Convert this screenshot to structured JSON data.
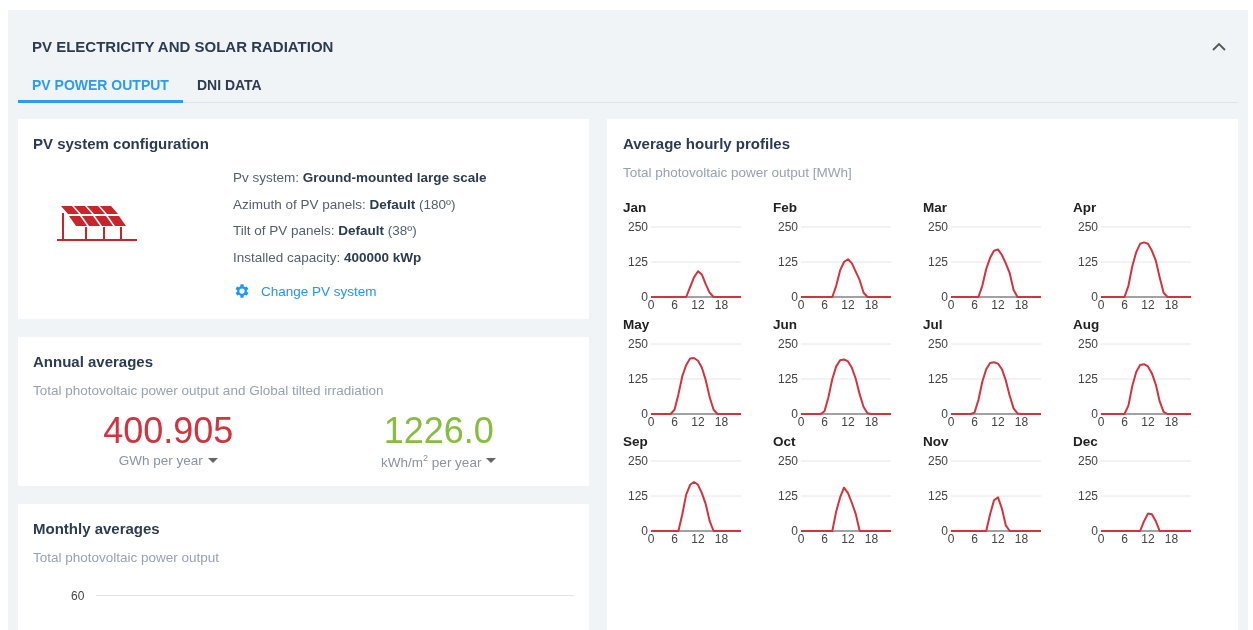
{
  "section": {
    "title": "PV ELECTRICITY AND SOLAR RADIATION",
    "expanded": true
  },
  "tabs": [
    {
      "label": "PV POWER OUTPUT",
      "selected": true
    },
    {
      "label": "DNI DATA",
      "selected": false
    }
  ],
  "config": {
    "title": "PV system configuration",
    "lines": [
      "Pv system: **Ground-mounted large scale**",
      "Azimuth of PV panels: **Default** (180º)",
      "Tilt of PV panels: **Default** (38º)",
      "Installed capacity: **400000 kWp**"
    ],
    "link": "Change PV system"
  },
  "annual": {
    "title": "Annual averages",
    "subtitle": "Total photovoltaic power output and Global tilted irradiation",
    "values": [
      {
        "value": "400.905",
        "unit": "GWh per year",
        "color": "#d0343f"
      },
      {
        "value": "1226.0",
        "unit": "kWh/m$^{2}$ per year",
        "color": "#86bd3f"
      }
    ]
  },
  "monthly": {
    "title": "Monthly averages",
    "subtitle": "Total photovoltaic power output",
    "y_tick_label": "60"
  },
  "hourly": {
    "title": "Average hourly profiles",
    "subtitle": "Total photovoltaic power output [MWh]",
    "charts": [
      {
        "chart_data": {
          "type": "line",
          "title": "Jan",
          "x": [
            0,
            1,
            2,
            3,
            4,
            5,
            6,
            7,
            8,
            9,
            10,
            11,
            12,
            13,
            14,
            15,
            16,
            17,
            18,
            19,
            20,
            21,
            22,
            23
          ],
          "series": [
            {
              "color": "#d0343f",
              "values": [
                0,
                0,
                0,
                0,
                0,
                0,
                0,
                0,
                0,
                0,
                35,
                70,
                92,
                80,
                45,
                15,
                0,
                0,
                0,
                0,
                0,
                0,
                0,
                0
              ]
            }
          ],
          "xlim": [
            0,
            23
          ],
          "ylim": [
            0,
            250
          ],
          "xticks": [
            0,
            6,
            12,
            18
          ],
          "yticks": [
            0,
            125,
            250
          ]
        }
      },
      {
        "chart_data": {
          "type": "line",
          "title": "Feb",
          "x": [
            0,
            1,
            2,
            3,
            4,
            5,
            6,
            7,
            8,
            9,
            10,
            11,
            12,
            13,
            14,
            15,
            16,
            17,
            18,
            19,
            20,
            21,
            22,
            23
          ],
          "series": [
            {
              "color": "#d0343f",
              "values": [
                0,
                0,
                0,
                0,
                0,
                0,
                0,
                0,
                0,
                40,
                95,
                125,
                135,
                120,
                90,
                60,
                15,
                0,
                0,
                0,
                0,
                0,
                0,
                0
              ]
            }
          ],
          "xlim": [
            0,
            23
          ],
          "ylim": [
            0,
            250
          ],
          "xticks": [
            0,
            6,
            12,
            18
          ],
          "yticks": [
            0,
            125,
            250
          ]
        }
      },
      {
        "chart_data": {
          "type": "line",
          "title": "Mar",
          "x": [
            0,
            1,
            2,
            3,
            4,
            5,
            6,
            7,
            8,
            9,
            10,
            11,
            12,
            13,
            14,
            15,
            16,
            17,
            18,
            19,
            20,
            21,
            22,
            23
          ],
          "series": [
            {
              "color": "#d0343f",
              "values": [
                0,
                0,
                0,
                0,
                0,
                0,
                0,
                0,
                40,
                100,
                140,
                165,
                170,
                150,
                120,
                85,
                25,
                0,
                0,
                0,
                0,
                0,
                0,
                0
              ]
            }
          ],
          "xlim": [
            0,
            23
          ],
          "ylim": [
            0,
            250
          ],
          "xticks": [
            0,
            6,
            12,
            18
          ],
          "yticks": [
            0,
            125,
            250
          ]
        }
      },
      {
        "chart_data": {
          "type": "line",
          "title": "Apr",
          "x": [
            0,
            1,
            2,
            3,
            4,
            5,
            6,
            7,
            8,
            9,
            10,
            11,
            12,
            13,
            14,
            15,
            16,
            17,
            18,
            19,
            20,
            21,
            22,
            23
          ],
          "series": [
            {
              "color": "#d0343f",
              "values": [
                0,
                0,
                0,
                0,
                0,
                0,
                0,
                40,
                110,
                160,
                190,
                195,
                190,
                165,
                130,
                70,
                15,
                0,
                0,
                0,
                0,
                0,
                0,
                0
              ]
            }
          ],
          "xlim": [
            0,
            23
          ],
          "ylim": [
            0,
            250
          ],
          "xticks": [
            0,
            6,
            12,
            18
          ],
          "yticks": [
            0,
            125,
            250
          ]
        }
      },
      {
        "chart_data": {
          "type": "line",
          "title": "May",
          "x": [
            0,
            1,
            2,
            3,
            4,
            5,
            6,
            7,
            8,
            9,
            10,
            11,
            12,
            13,
            14,
            15,
            16,
            17,
            18,
            19,
            20,
            21,
            22,
            23
          ],
          "series": [
            {
              "color": "#d0343f",
              "values": [
                0,
                0,
                0,
                0,
                0,
                0,
                15,
                70,
                135,
                175,
                198,
                200,
                190,
                165,
                120,
                60,
                15,
                0,
                0,
                0,
                0,
                0,
                0,
                0
              ]
            }
          ],
          "xlim": [
            0,
            23
          ],
          "ylim": [
            0,
            250
          ],
          "xticks": [
            0,
            6,
            12,
            18
          ],
          "yticks": [
            0,
            125,
            250
          ]
        }
      },
      {
        "chart_data": {
          "type": "line",
          "title": "Jun",
          "x": [
            0,
            1,
            2,
            3,
            4,
            5,
            6,
            7,
            8,
            9,
            10,
            11,
            12,
            13,
            14,
            15,
            16,
            17,
            18,
            19,
            20,
            21,
            22,
            23
          ],
          "series": [
            {
              "color": "#d0343f",
              "values": [
                0,
                0,
                0,
                0,
                0,
                0,
                10,
                60,
                125,
                170,
                192,
                195,
                188,
                165,
                125,
                70,
                25,
                3,
                0,
                0,
                0,
                0,
                0,
                0
              ]
            }
          ],
          "xlim": [
            0,
            23
          ],
          "ylim": [
            0,
            250
          ],
          "xticks": [
            0,
            6,
            12,
            18
          ],
          "yticks": [
            0,
            125,
            250
          ]
        }
      },
      {
        "chart_data": {
          "type": "line",
          "title": "Jul",
          "x": [
            0,
            1,
            2,
            3,
            4,
            5,
            6,
            7,
            8,
            9,
            10,
            11,
            12,
            13,
            14,
            15,
            16,
            17,
            18,
            19,
            20,
            21,
            22,
            23
          ],
          "series": [
            {
              "color": "#d0343f",
              "values": [
                0,
                0,
                0,
                0,
                0,
                0,
                5,
                50,
                115,
                160,
                182,
                185,
                180,
                160,
                120,
                65,
                20,
                2,
                0,
                0,
                0,
                0,
                0,
                0
              ]
            }
          ],
          "xlim": [
            0,
            23
          ],
          "ylim": [
            0,
            250
          ],
          "xticks": [
            0,
            6,
            12,
            18
          ],
          "yticks": [
            0,
            125,
            250
          ]
        }
      },
      {
        "chart_data": {
          "type": "line",
          "title": "Aug",
          "x": [
            0,
            1,
            2,
            3,
            4,
            5,
            6,
            7,
            8,
            9,
            10,
            11,
            12,
            13,
            14,
            15,
            16,
            17,
            18,
            19,
            20,
            21,
            22,
            23
          ],
          "series": [
            {
              "color": "#d0343f",
              "values": [
                0,
                0,
                0,
                0,
                0,
                0,
                0,
                30,
                100,
                150,
                175,
                178,
                170,
                145,
                105,
                45,
                8,
                0,
                0,
                0,
                0,
                0,
                0,
                0
              ]
            }
          ],
          "xlim": [
            0,
            23
          ],
          "ylim": [
            0,
            250
          ],
          "xticks": [
            0,
            6,
            12,
            18
          ],
          "yticks": [
            0,
            125,
            250
          ]
        }
      },
      {
        "chart_data": {
          "type": "line",
          "title": "Sep",
          "x": [
            0,
            1,
            2,
            3,
            4,
            5,
            6,
            7,
            8,
            9,
            10,
            11,
            12,
            13,
            14,
            15,
            16,
            17,
            18,
            19,
            20,
            21,
            22,
            23
          ],
          "series": [
            {
              "color": "#d0343f",
              "values": [
                0,
                0,
                0,
                0,
                0,
                0,
                0,
                0,
                60,
                130,
                165,
                175,
                165,
                135,
                95,
                35,
                0,
                0,
                0,
                0,
                0,
                0,
                0,
                0
              ]
            }
          ],
          "xlim": [
            0,
            23
          ],
          "ylim": [
            0,
            250
          ],
          "xticks": [
            0,
            6,
            12,
            18
          ],
          "yticks": [
            0,
            125,
            250
          ]
        }
      },
      {
        "chart_data": {
          "type": "line",
          "title": "Oct",
          "x": [
            0,
            1,
            2,
            3,
            4,
            5,
            6,
            7,
            8,
            9,
            10,
            11,
            12,
            13,
            14,
            15,
            16,
            17,
            18,
            19,
            20,
            21,
            22,
            23
          ],
          "series": [
            {
              "color": "#d0343f",
              "values": [
                0,
                0,
                0,
                0,
                0,
                0,
                0,
                0,
                0,
                70,
                120,
                155,
                135,
                100,
                60,
                0,
                0,
                0,
                0,
                0,
                0,
                0,
                0,
                0
              ]
            }
          ],
          "xlim": [
            0,
            23
          ],
          "ylim": [
            0,
            250
          ],
          "xticks": [
            0,
            6,
            12,
            18
          ],
          "yticks": [
            0,
            125,
            250
          ]
        }
      },
      {
        "chart_data": {
          "type": "line",
          "title": "Nov",
          "x": [
            0,
            1,
            2,
            3,
            4,
            5,
            6,
            7,
            8,
            9,
            10,
            11,
            12,
            13,
            14,
            15,
            16,
            17,
            18,
            19,
            20,
            21,
            22,
            23
          ],
          "series": [
            {
              "color": "#d0343f",
              "values": [
                0,
                0,
                0,
                0,
                0,
                0,
                0,
                0,
                0,
                0,
                60,
                110,
                120,
                80,
                20,
                0,
                0,
                0,
                0,
                0,
                0,
                0,
                0,
                0
              ]
            }
          ],
          "xlim": [
            0,
            23
          ],
          "ylim": [
            0,
            250
          ],
          "xticks": [
            0,
            6,
            12,
            18
          ],
          "yticks": [
            0,
            125,
            250
          ]
        }
      },
      {
        "chart_data": {
          "type": "line",
          "title": "Dec",
          "x": [
            0,
            1,
            2,
            3,
            4,
            5,
            6,
            7,
            8,
            9,
            10,
            11,
            12,
            13,
            14,
            15,
            16,
            17,
            18,
            19,
            20,
            21,
            22,
            23
          ],
          "series": [
            {
              "color": "#d0343f",
              "values": [
                0,
                0,
                0,
                0,
                0,
                0,
                0,
                0,
                0,
                0,
                0,
                35,
                62,
                60,
                35,
                0,
                0,
                0,
                0,
                0,
                0,
                0,
                0,
                0
              ]
            }
          ],
          "xlim": [
            0,
            23
          ],
          "ylim": [
            0,
            250
          ],
          "xticks": [
            0,
            6,
            12,
            18
          ],
          "yticks": [
            0,
            125,
            250
          ]
        }
      }
    ]
  }
}
